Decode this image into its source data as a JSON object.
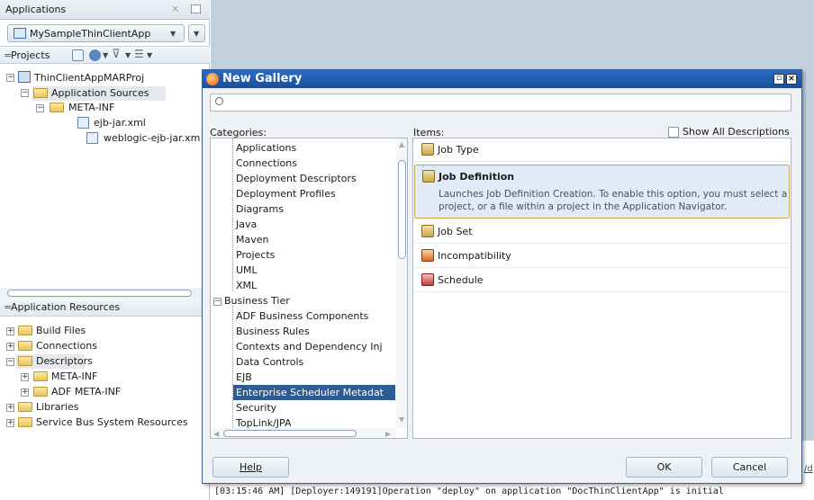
{
  "applications_panel": {
    "title": "Applications",
    "app_name": "MySampleThinClientApp",
    "projects_label": "Projects",
    "tree": {
      "project": "ThinClientAppMARProj",
      "app_sources": "Application Sources",
      "meta_inf": "META-INF",
      "file1": "ejb-jar.xml",
      "file2": "weblogic-ejb-jar.xm"
    }
  },
  "resources_panel": {
    "title": "Application Resources",
    "items": [
      "Build Files",
      "Connections",
      "Descriptors",
      "META-INF",
      "ADF META-INF",
      "Libraries",
      "Service Bus System Resources"
    ]
  },
  "dialog": {
    "title": "New Gallery",
    "search_placeholder": "",
    "categories_label": "Categories:",
    "items_label": "Items:",
    "show_all": "Show All Descriptions",
    "categories": [
      "Applications",
      "Connections",
      "Deployment Descriptors",
      "Deployment Profiles",
      "Diagrams",
      "Java",
      "Maven",
      "Projects",
      "UML",
      "XML"
    ],
    "business_tier": "Business Tier",
    "business_children": [
      "ADF Business Components",
      "Business Rules",
      "Contexts and Dependency Inj",
      "Data Controls",
      "EJB",
      "Enterprise Scheduler Metadat",
      "Security",
      "TopLink/JPA"
    ],
    "items": [
      {
        "label": "Job Type",
        "icon": "job-type-icon"
      },
      {
        "label": "Job Definition",
        "icon": "job-definition-icon",
        "description": "Launches Job Definition Creation. To enable this option, you must select a project, or a file within a project in the Application Navigator."
      },
      {
        "label": "Job Set",
        "icon": "job-set-icon"
      },
      {
        "label": "Incompatibility",
        "icon": "incompatibility-icon"
      },
      {
        "label": "Schedule",
        "icon": "schedule-icon"
      }
    ],
    "help": "Help",
    "ok": "OK",
    "cancel": "Cancel"
  },
  "log": {
    "line": "[03:15:46 AM] [Deployer:149191]Operation \"deploy\" on application \"DocThinClientApp\" is initial",
    "side_link": "/d"
  },
  "colors": {
    "title_bar": "#1d5aa8",
    "selection": "#2f5b93",
    "highlight_item": "#e0ebf7"
  }
}
